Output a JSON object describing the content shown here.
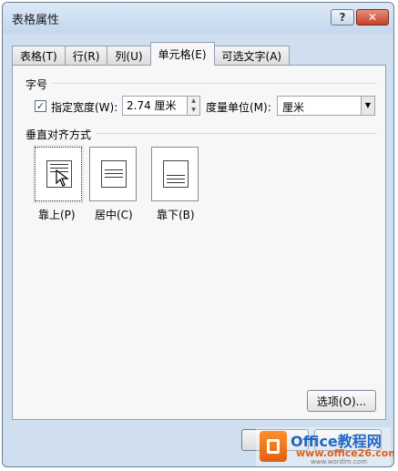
{
  "title": "表格属性",
  "titlebar": {
    "help": "?",
    "close": "✕"
  },
  "tabs": [
    {
      "label": "表格(T)",
      "active": false
    },
    {
      "label": "行(R)",
      "active": false
    },
    {
      "label": "列(U)",
      "active": false
    },
    {
      "label": "单元格(E)",
      "active": true
    },
    {
      "label": "可选文字(A)",
      "active": false
    }
  ],
  "size_section": {
    "title": "字号",
    "specify_width": {
      "checked": true,
      "label": "指定宽度(W):",
      "value": "2.74 厘米"
    },
    "measure_unit": {
      "label": "度量单位(M):",
      "value": "厘米"
    }
  },
  "vertical_alignment": {
    "title": "垂直对齐方式",
    "options": [
      {
        "label": "靠上(P)",
        "selected": true
      },
      {
        "label": "居中(C)",
        "selected": false
      },
      {
        "label": "靠下(B)",
        "selected": false
      }
    ]
  },
  "options_button": "选项(O)...",
  "watermark": {
    "brand": "Office教程网",
    "site": "www.office26.com",
    "site_small": "www.wordlm.com"
  },
  "colors": {
    "dialog_bg": "#cfdff0",
    "panel_bg": "#f7f7f7",
    "close_red": "#c7402a",
    "watermark_orange": "#e35f12",
    "watermark_blue": "#1f67c7"
  }
}
